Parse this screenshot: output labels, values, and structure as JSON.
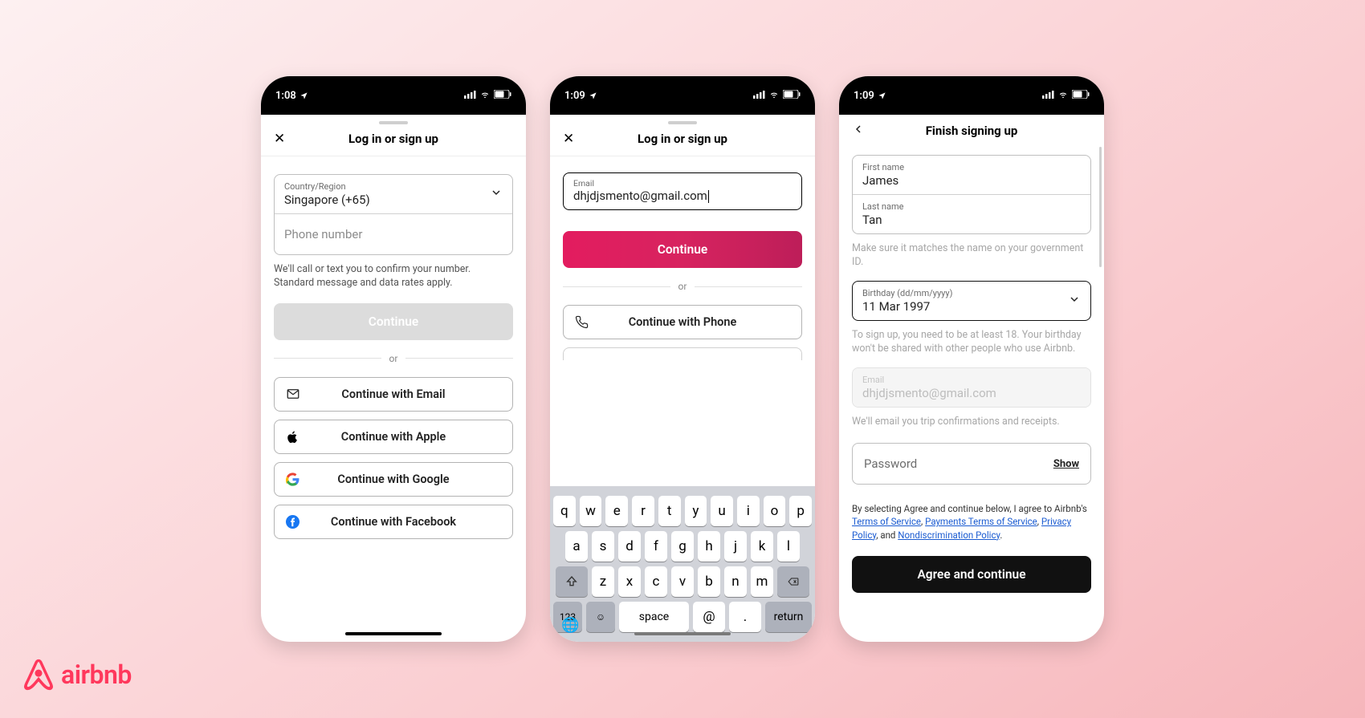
{
  "brand": "airbnb",
  "screens": {
    "phone_login": {
      "status_time": "1:08",
      "title": "Log in or sign up",
      "country_label": "Country/Region",
      "country_value": "Singapore (+65)",
      "phone_placeholder": "Phone number",
      "helper": "We'll call or text you to confirm your number. Standard message and data rates apply.",
      "continue_label": "Continue",
      "or_label": "or",
      "opt_email": "Continue with Email",
      "opt_apple": "Continue with Apple",
      "opt_google": "Continue with Google",
      "opt_facebook": "Continue with Facebook"
    },
    "email_login": {
      "status_time": "1:09",
      "title": "Log in or sign up",
      "email_label": "Email",
      "email_value": "dhjdjsmento@gmail.com",
      "continue_label": "Continue",
      "or_label": "or",
      "opt_phone": "Continue with Phone",
      "keyboard": {
        "row1": [
          "q",
          "w",
          "e",
          "r",
          "t",
          "y",
          "u",
          "i",
          "o",
          "p"
        ],
        "row2": [
          "a",
          "s",
          "d",
          "f",
          "g",
          "h",
          "j",
          "k",
          "l"
        ],
        "row3": [
          "z",
          "x",
          "c",
          "v",
          "b",
          "n",
          "m"
        ],
        "space": "space",
        "at": "@",
        "dot": ".",
        "return": "return",
        "numeric": "123"
      }
    },
    "signup": {
      "status_time": "1:09",
      "title": "Finish signing up",
      "first_name_label": "First name",
      "first_name_value": "James",
      "last_name_label": "Last name",
      "last_name_value": "Tan",
      "name_helper": "Make sure it matches the name on your government ID.",
      "birthday_label": "Birthday (dd/mm/yyyy)",
      "birthday_value": "11 Mar 1997",
      "birthday_helper": "To sign up, you need to be at least 18. Your birthday won't be shared with other people who use Airbnb.",
      "email_label": "Email",
      "email_value": "dhjdjsmento@gmail.com",
      "email_helper": "We'll email you trip confirmations and receipts.",
      "password_placeholder": "Password",
      "password_show": "Show",
      "legal_prefix": "By selecting Agree and continue below, I agree to Airbnb's ",
      "legal_tos": "Terms of Service",
      "legal_pay": "Payments Terms of Service",
      "legal_privacy": "Privacy Policy",
      "legal_and": ", and ",
      "legal_nd": "Nondiscrimination Policy",
      "agree_label": "Agree and continue"
    }
  }
}
